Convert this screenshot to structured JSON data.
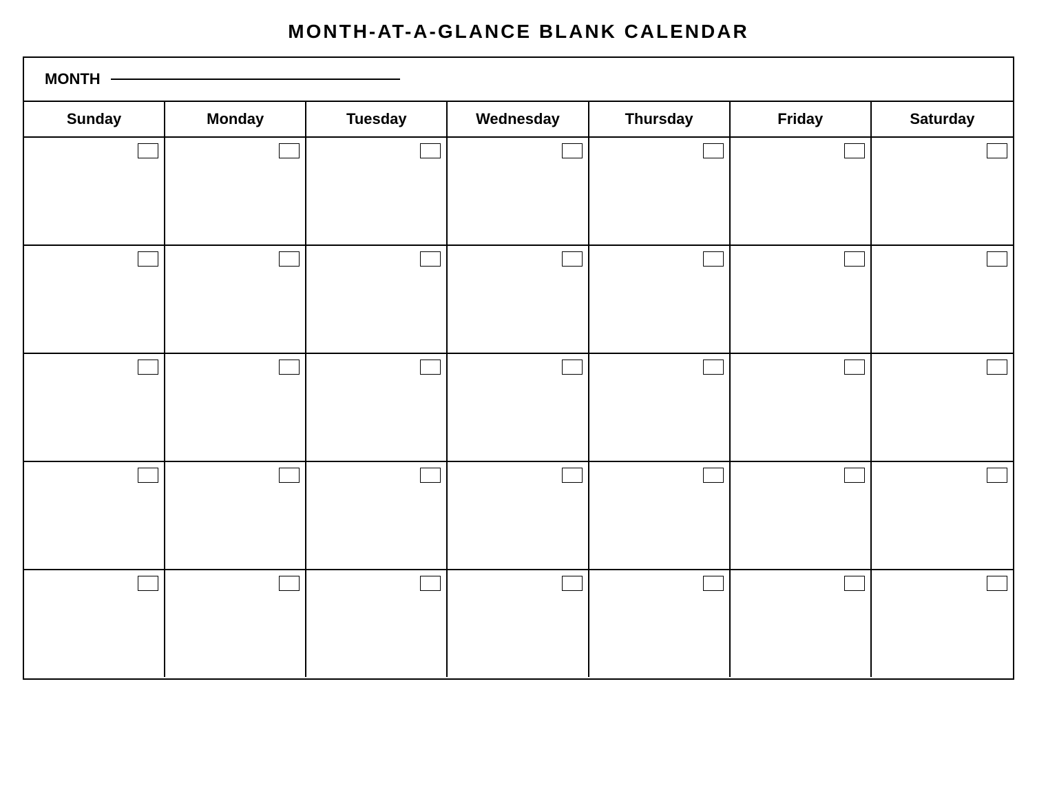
{
  "title": "MONTH-AT-A-GLANCE  BLANK  CALENDAR",
  "month_label": "MONTH",
  "days": [
    "Sunday",
    "Monday",
    "Tuesday",
    "Wednesday",
    "Thursday",
    "Friday",
    "Saturday"
  ],
  "num_rows": 5,
  "num_cols": 7
}
